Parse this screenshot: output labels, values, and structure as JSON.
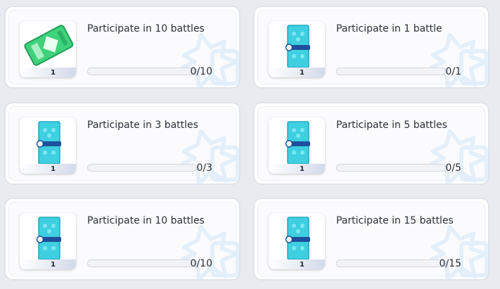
{
  "quests": [
    {
      "title": "Participate in 10 battles",
      "progress_text": "0/10",
      "progress": 0,
      "quantity": "1",
      "reward": "green-ticket-icon"
    },
    {
      "title": "Participate in 1 battle",
      "progress_text": "0/1",
      "progress": 0,
      "quantity": "1",
      "reward": "card-pack-icon"
    },
    {
      "title": "Participate in 3 battles",
      "progress_text": "0/3",
      "progress": 0,
      "quantity": "1",
      "reward": "card-pack-icon"
    },
    {
      "title": "Participate in 5 battles",
      "progress_text": "0/5",
      "progress": 0,
      "quantity": "1",
      "reward": "card-pack-icon"
    },
    {
      "title": "Participate in 10 battles",
      "progress_text": "0/10",
      "progress": 0,
      "quantity": "1",
      "reward": "card-pack-icon"
    },
    {
      "title": "Participate in 15 battles",
      "progress_text": "0/15",
      "progress": 0,
      "quantity": "1",
      "reward": "card-pack-icon"
    }
  ],
  "colors": {
    "pack": "#3ecfe0",
    "ticket": "#3fd27a",
    "watermark": "#cfe6f7"
  }
}
